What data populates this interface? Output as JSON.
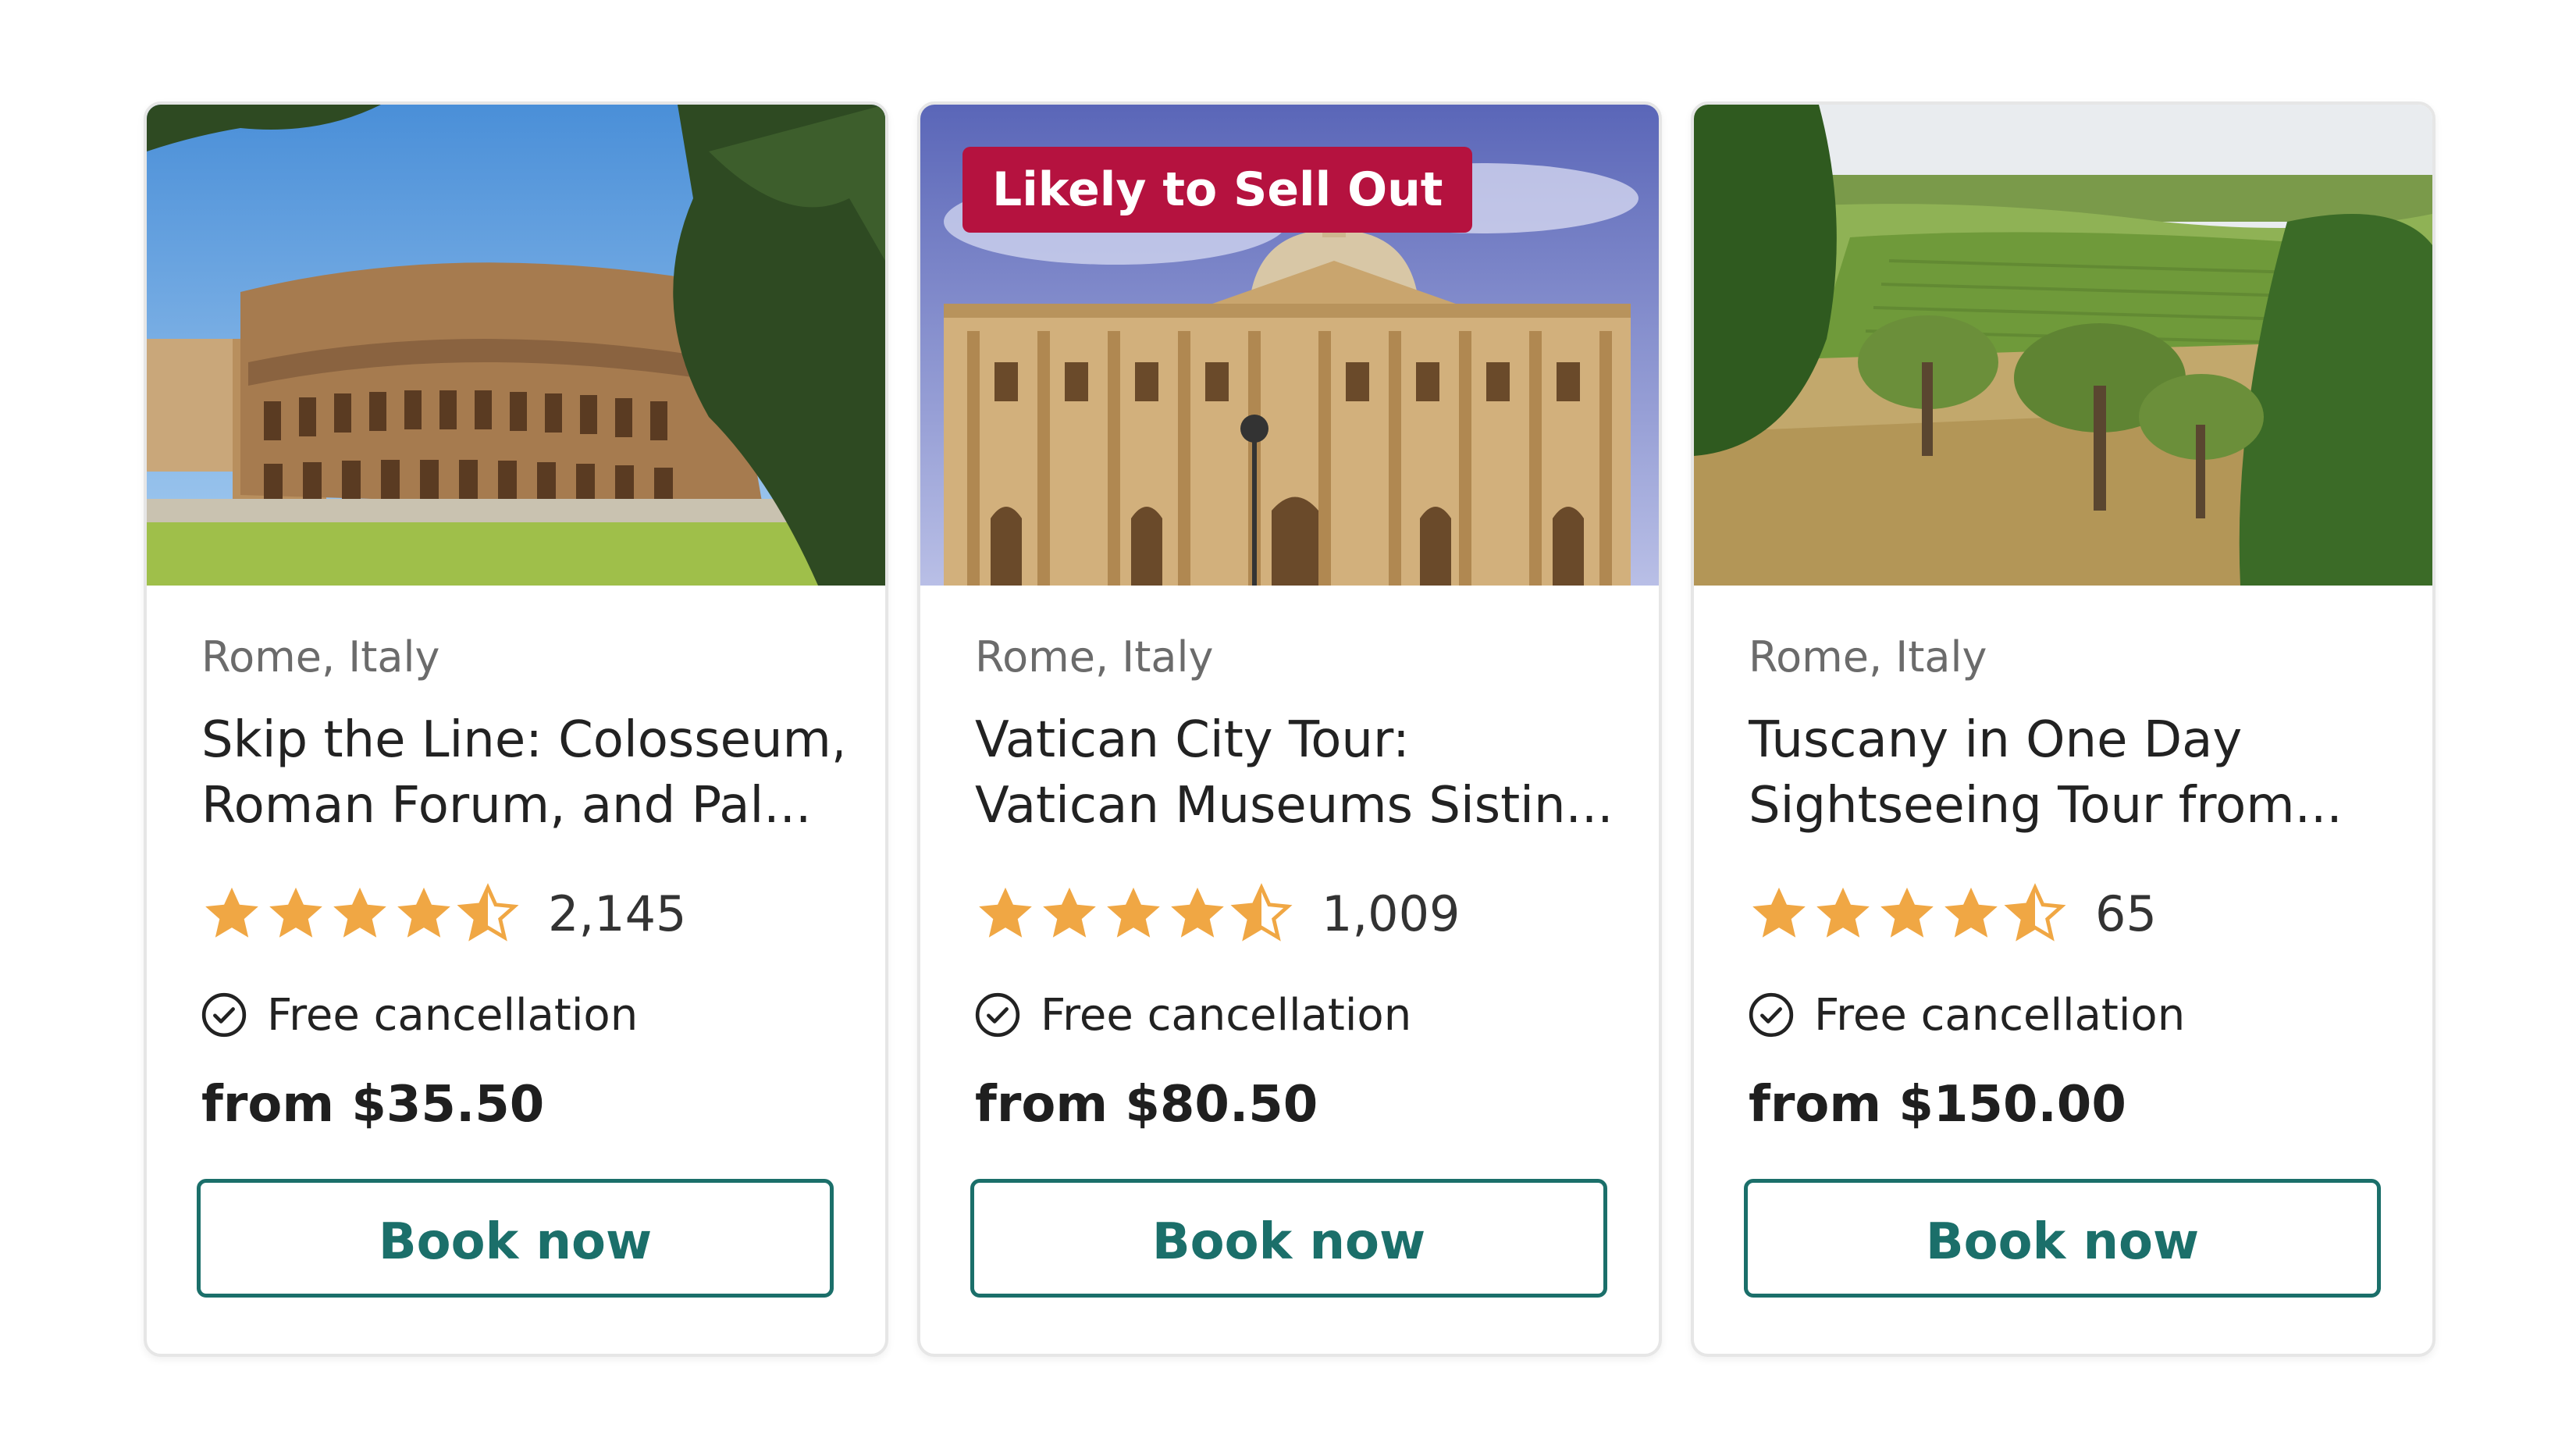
{
  "colors": {
    "star": "#f0a744",
    "badge": "#b5123f",
    "button_border": "#1b6f6a",
    "button_text": "#1b6f6a"
  },
  "cards": [
    {
      "image": "colosseum-photo",
      "badge": "",
      "location": "Rome, Italy",
      "title_line1": "Skip the Line: Colosseum,",
      "title_line2": "Roman Forum, and Pal...",
      "rating": 4.5,
      "reviews": "2,145",
      "cancellation": "Free cancellation",
      "price": "from $35.50",
      "button": "Book now"
    },
    {
      "image": "vatican-photo",
      "badge": "Likely to Sell Out",
      "location": "Rome, Italy",
      "title_line1": "Vatican City Tour:",
      "title_line2": "Vatican Museums Sistin...",
      "rating": 4.5,
      "reviews": "1,009",
      "cancellation": "Free cancellation",
      "price": "from $80.50",
      "button": "Book now"
    },
    {
      "image": "tuscany-photo",
      "badge": "",
      "location": "Rome, Italy",
      "title_line1": "Tuscany in One Day",
      "title_line2": "Sightseeing Tour from...",
      "rating": 4.5,
      "reviews": "65",
      "cancellation": "Free cancellation",
      "price": "from $150.00",
      "button": "Book now"
    }
  ]
}
